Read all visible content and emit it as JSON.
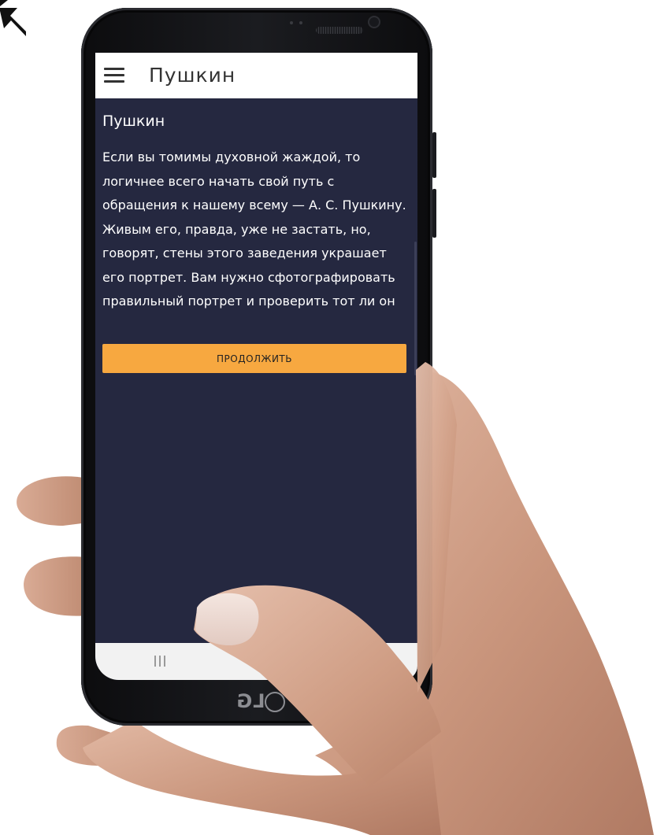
{
  "app_bar": {
    "title": "Пушкин"
  },
  "content": {
    "title": "Пушкин",
    "body": "Если вы томимы духовной жаждой, то логичнее всего начать свой путь с обращения к нашему всему — А. С. Пушкину. Живым его, правда, уже не застать, но, говорят, стены этого заведения украшает его портрет. Вам нужно сфотографировать правильный портрет и проверить тот ли он",
    "continue_label": "ПРОДОЛЖИТЬ"
  },
  "device": {
    "brand": "LG"
  },
  "icons": {
    "menu": "hamburger-menu-icon",
    "recent_apps": "recent-apps-icon",
    "corner_arrow": "arrow-icon"
  },
  "colors": {
    "screen_background": "#252840",
    "app_bar_background": "#ffffff",
    "accent_button": "#f7a840",
    "nav_bar_background": "#f2f2f2"
  }
}
